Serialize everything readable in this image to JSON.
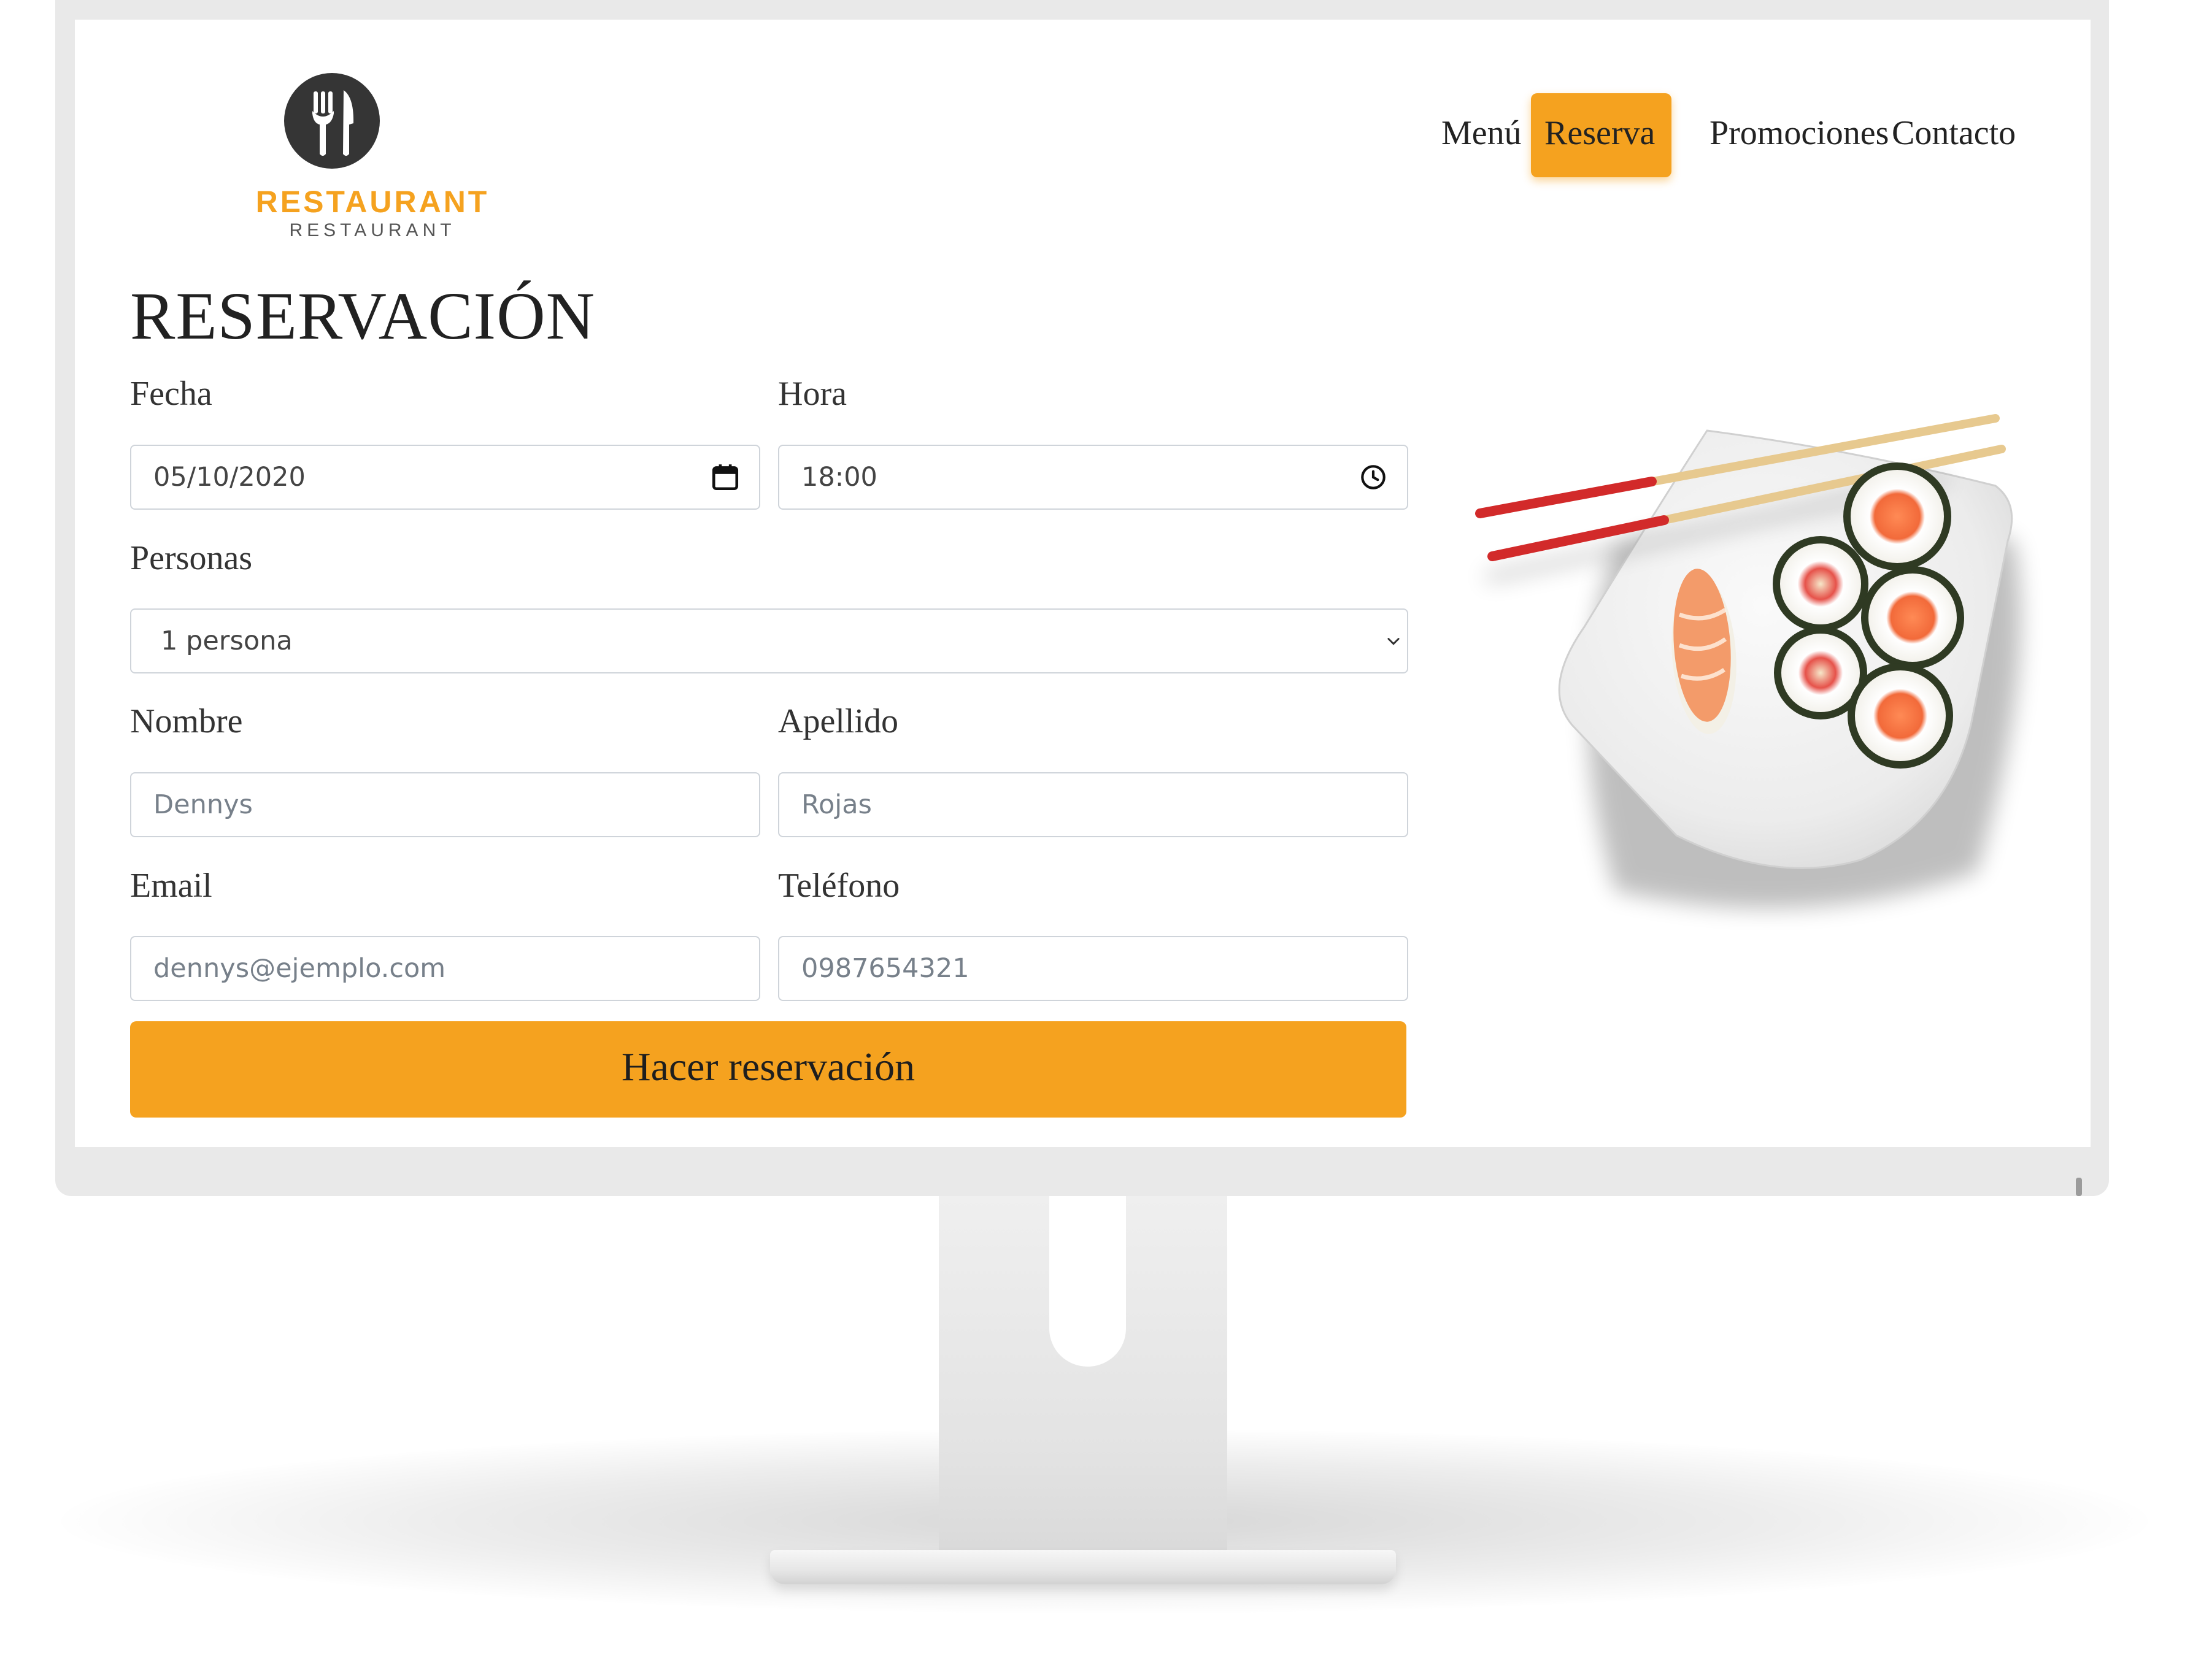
{
  "brand": {
    "name": "RESTAURANT",
    "subtitle": "RESTAURANT",
    "accent_color": "#f5a21f",
    "logo_icon": "fork-knife-icon"
  },
  "nav": {
    "items": [
      {
        "label": "Menú",
        "active": false
      },
      {
        "label": "Reserva",
        "active": true
      },
      {
        "label": "Promociones",
        "active": false
      },
      {
        "label": "Contacto",
        "active": false
      }
    ]
  },
  "form": {
    "title": "RESERVACIÓN",
    "fecha": {
      "label": "Fecha",
      "value": "05/10/2020",
      "icon": "calendar-icon"
    },
    "hora": {
      "label": "Hora",
      "value": "18:00",
      "icon": "clock-icon"
    },
    "personas": {
      "label": "Personas",
      "selected": "1 persona",
      "icon": "chevron-down-icon"
    },
    "nombre": {
      "label": "Nombre",
      "placeholder": "Dennys"
    },
    "apellido": {
      "label": "Apellido",
      "placeholder": "Rojas"
    },
    "email": {
      "label": "Email",
      "placeholder": "dennys@ejemplo.com"
    },
    "telefono": {
      "label": "Teléfono",
      "placeholder": "0987654321"
    },
    "submit_label": "Hacer reservación"
  },
  "hero_image": {
    "subject": "sushi-plate-image"
  }
}
